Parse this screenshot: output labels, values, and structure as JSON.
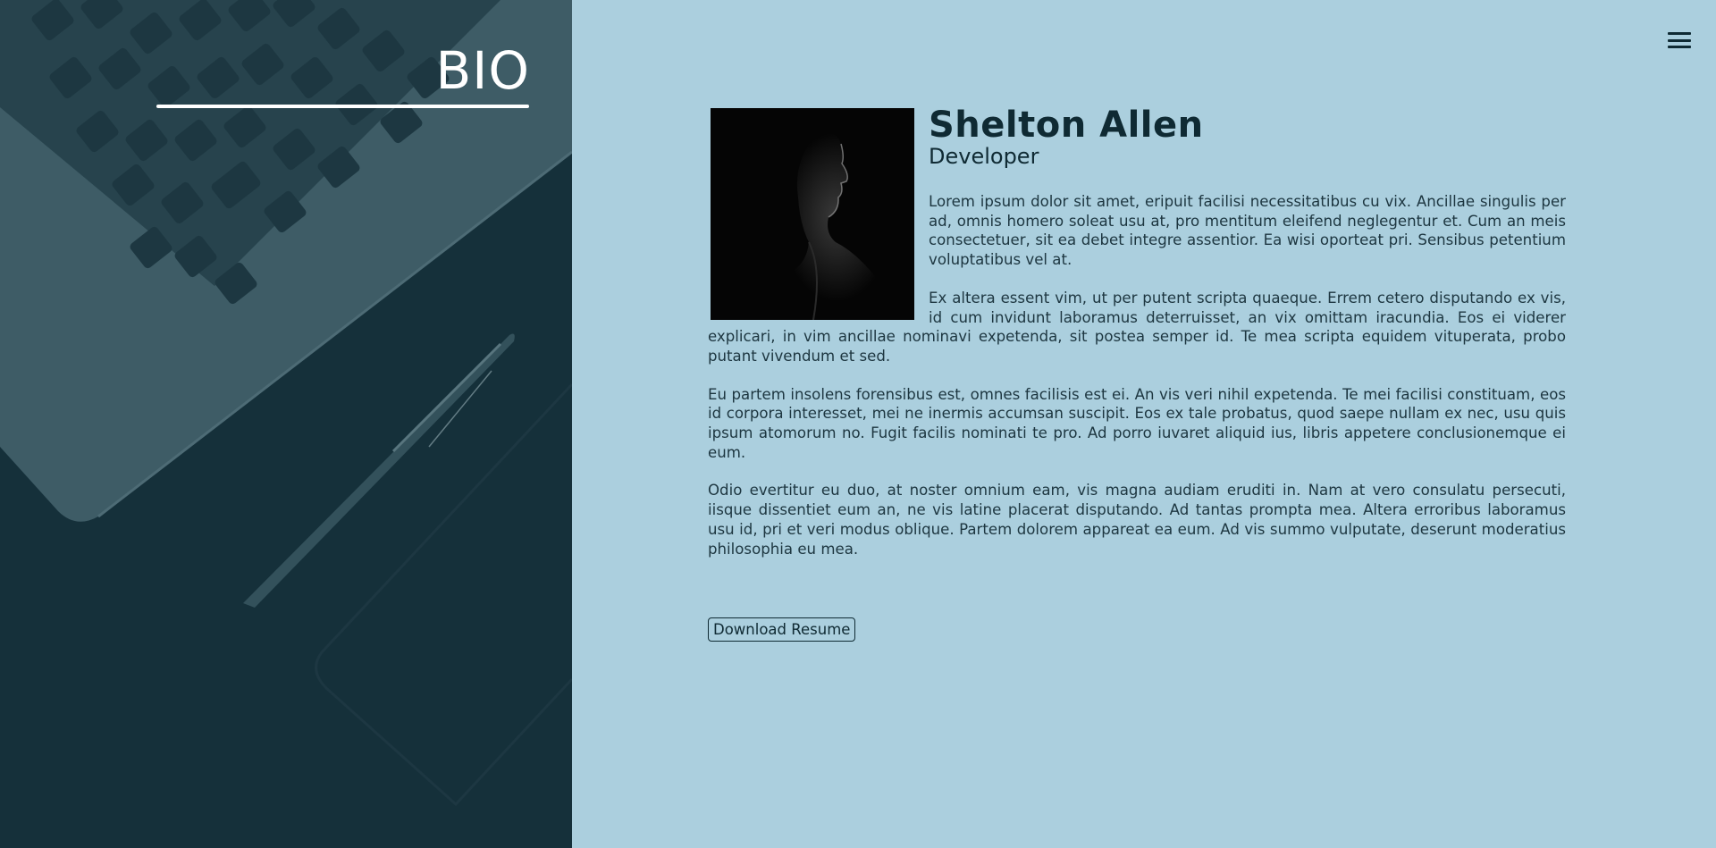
{
  "hero": {
    "title": "BIO",
    "background": "laptop-and-pen-desk-photo"
  },
  "menu": {
    "icon": "hamburger-menu-icon"
  },
  "profile": {
    "name": "Shelton Allen",
    "role": "Developer",
    "photo": "man-profile-silhouette-photo",
    "paragraphs": [
      "Lorem ipsum dolor sit amet, eripuit facilisi necessitatibus cu vix. Ancillae singulis per ad, omnis homero soleat usu at, pro mentitum eleifend neglegentur et. Cum an meis consectetuer, sit ea debet integre assentior. Ea wisi oporteat pri. Sensibus petentium voluptatibus vel at.",
      "Ex altera essent vim, ut per putent scripta quaeque. Errem cetero disputando ex vis, id cum invidunt laboramus deterruisset, an vix omittam iracundia. Eos ei viderer explicari, in vim ancillae nominavi expetenda, sit postea semper id. Te mea scripta equidem vituperata, probo putant vivendum et sed.",
      "Eu partem insolens forensibus est, omnes facilisis est ei. An vis veri nihil expetenda. Te mei facilisi constituam, eos id corpora interesset, mei ne inermis accumsan suscipit. Eos ex tale probatus, quod saepe nullam ex nec, usu quis ipsum atomorum no. Fugit facilis nominati te pro. Ad porro iuvaret aliquid ius, libris appetere conclusionemque ei eum.",
      "Odio evertitur eu duo, at noster omnium eam, vis magna audiam eruditi in. Nam at vero consulatu persecuti, iisque dissentiet eum an, ne vis latine placerat disputando. Ad tantas prompta mea. Altera erroribus laboramus usu id, pri et veri modus oblique. Partem dolorem appareat ea eum. Ad vis summo vulputate, deserunt moderatius philosophia eu mea."
    ],
    "download_label": "Download Resume"
  },
  "colors": {
    "page_background": "#abcfde",
    "hero_overlay": "#16313a",
    "text_dark": "#0f2a33"
  }
}
